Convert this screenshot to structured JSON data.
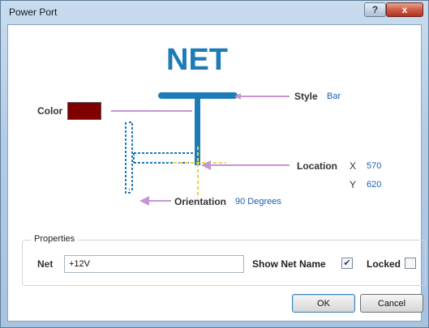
{
  "window": {
    "title": "Power Port",
    "help_label": "?",
    "close_label": "x"
  },
  "diagram": {
    "net_text": "NET",
    "style_label": "Style",
    "style_value": "Bar",
    "color_label": "Color",
    "color_value": "#800000",
    "location_label": "Location",
    "x_label": "X",
    "x_value": "570",
    "y_label": "Y",
    "y_value": "620",
    "orientation_label": "Orientation",
    "orientation_value": "90 Degrees"
  },
  "properties": {
    "group_title": "Properties",
    "net_label": "Net",
    "net_value": "+12V",
    "show_net_name_label": "Show Net Name",
    "show_net_name_checked": true,
    "locked_label": "Locked",
    "locked_checked": false
  },
  "buttons": {
    "ok": "OK",
    "cancel": "Cancel"
  },
  "colors": {
    "symbol_blue": "#1d7bb8",
    "pointer_purple": "#c596d2",
    "crosshair_yellow": "#f0d23c",
    "value_blue": "#1a5fb4"
  }
}
